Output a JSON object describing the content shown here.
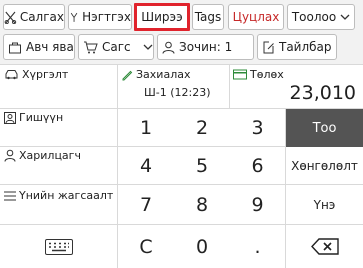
{
  "toolbar": {
    "salgah": "Салгах",
    "negtgeh": "Нэгтгэх",
    "shiree": "Ширээ",
    "tags": "Tags",
    "tsutslah": "Цуцлах",
    "tooloo": "Тоолоо"
  },
  "row2": {
    "avch_yavah": "Авч явах",
    "sags": "Сагс",
    "zochin": "Зочин: 1",
    "taibar": "Тайлбар"
  },
  "info": {
    "hurgelt": "Хүргэлт",
    "zahialah": "Захиалах",
    "shift": "Ш-1 (12:23)",
    "tolokh": "Төлөх",
    "amount": "23,010",
    "gishuun": "Гишүүн",
    "haritsagch": "Харилцагч",
    "unii_jagsaalt": "Үнийн жагсаалт"
  },
  "keypad": {
    "k1": "1",
    "k2": "2",
    "k3": "3",
    "k4": "4",
    "k5": "5",
    "k6": "6",
    "k7": "7",
    "k8": "8",
    "k9": "9",
    "kc": "C",
    "k0": "0",
    "kdot": "."
  },
  "side": {
    "too": "Тоо",
    "hongololt": "Хөнгөлөлт",
    "une": "Үнэ"
  },
  "colors": {
    "highlight": "#e0232c",
    "cancel_text": "#c62828",
    "selected_key": "#545454",
    "money_icon": "#2e8b3a"
  }
}
